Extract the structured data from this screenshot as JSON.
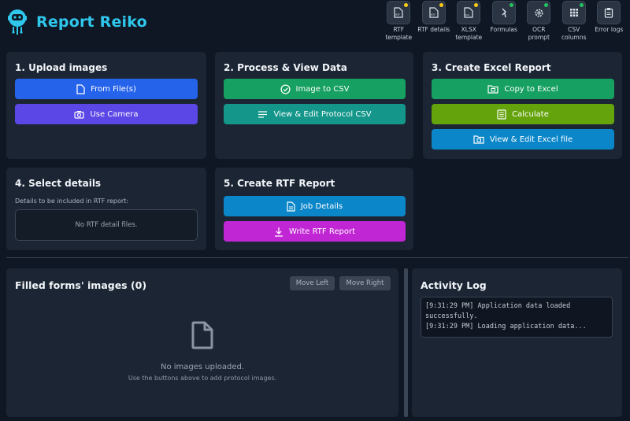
{
  "app": {
    "title": "Report Reiko"
  },
  "colors": {
    "brand": "#2fc7ec",
    "blue": "#2563eb",
    "indigo": "#5b46e6",
    "green": "#16a061",
    "teal": "#14978a",
    "lime": "#65a30d",
    "sky": "#0b86c9",
    "magenta": "#c026d3"
  },
  "toolbar": [
    {
      "label": "RTF template",
      "icon": "rtf-file-icon",
      "status": "yellow"
    },
    {
      "label": "RTF details",
      "icon": "rtf-details-icon",
      "status": "yellow"
    },
    {
      "label": "XLSX template",
      "icon": "xlsx-file-icon",
      "status": "yellow"
    },
    {
      "label": "Formulas",
      "icon": "formula-icon",
      "status": "green"
    },
    {
      "label": "OCR prompt",
      "icon": "gear-icon",
      "status": "green"
    },
    {
      "label": "CSV columns",
      "icon": "grid-icon",
      "status": "green"
    },
    {
      "label": "Error logs",
      "icon": "clipboard-icon",
      "status": ""
    }
  ],
  "upload": {
    "title": "1. Upload images",
    "from_files": "From File(s)",
    "use_camera": "Use Camera"
  },
  "process": {
    "title": "2. Process & View Data",
    "image_to_csv": "Image to CSV",
    "view_edit_csv": "View & Edit Protocol CSV"
  },
  "excel": {
    "title": "3. Create Excel Report",
    "copy": "Copy to Excel",
    "calculate": "Calculate",
    "view_edit": "View & Edit Excel file"
  },
  "details": {
    "title": "4. Select details",
    "subtitle": "Details to be included in RTF report:",
    "empty": "No RTF detail files."
  },
  "rtf": {
    "title": "5. Create RTF Report",
    "job_details": "Job Details",
    "write": "Write RTF Report"
  },
  "images": {
    "title": "Filled forms' images (0)",
    "move_left": "Move Left",
    "move_right": "Move Right",
    "empty_title": "No images uploaded.",
    "empty_hint": "Use the buttons above to add protocol images."
  },
  "log": {
    "title": "Activity Log",
    "lines": [
      "[9:31:29 PM] Application data loaded",
      "successfully.",
      "[9:31:29 PM] Loading application data..."
    ]
  }
}
